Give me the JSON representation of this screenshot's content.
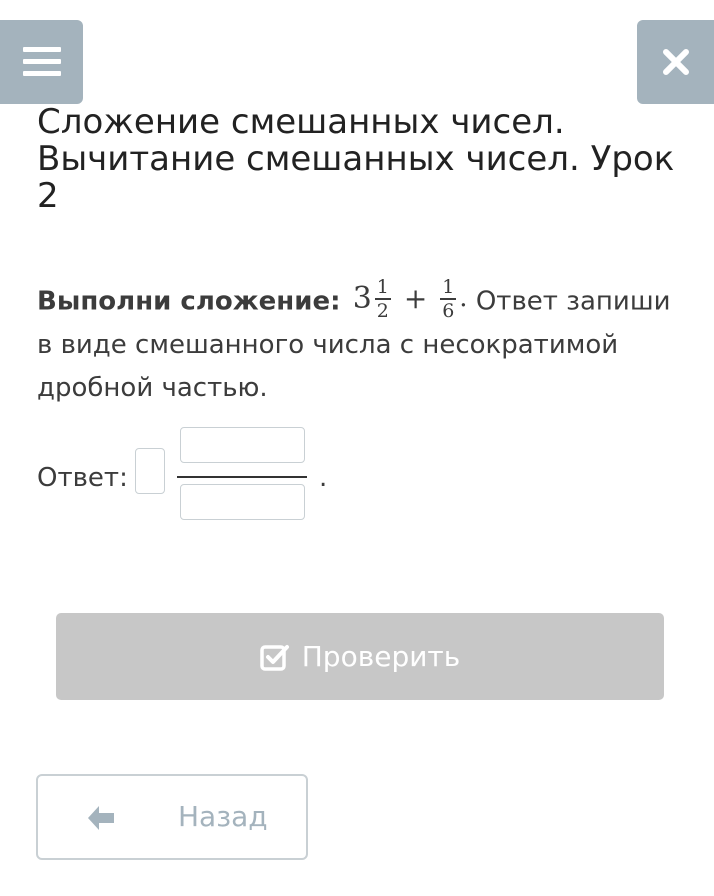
{
  "header": {
    "menu_icon": "hamburger-menu-icon",
    "close_icon": "close-x-icon",
    "button_color": "#a4b3bd"
  },
  "title": "Сложение смешанных чисел. Вычитание смешанных чисел. Урок 2",
  "task": {
    "instruction_bold": "Выполни сложение:",
    "expression": {
      "whole": "3",
      "frac1_num": "1",
      "frac1_den": "2",
      "operator": "+",
      "frac2_num": "1",
      "frac2_den": "6",
      "end": "."
    },
    "instruction_rest": "Ответ запиши в виде смешанного числа с несократимой дробной частью."
  },
  "answer": {
    "label": "Ответ:",
    "whole_value": "",
    "numerator_value": "",
    "denominator_value": "",
    "trailing": "."
  },
  "check_button": {
    "label": "Проверить",
    "icon": "checkbox-check-icon",
    "color": "#c7c7c7"
  },
  "back_button": {
    "label": "Назад",
    "icon": "arrow-left-icon"
  }
}
